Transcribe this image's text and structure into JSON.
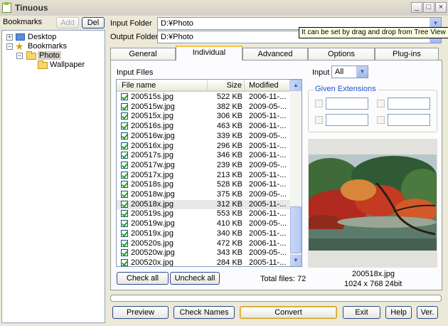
{
  "app": {
    "title": "Tinuous"
  },
  "window_controls": {
    "minimize": "_",
    "maximize": "□",
    "close": "×"
  },
  "bookmarks": {
    "label": "Bookmarks",
    "add_label": "Add",
    "del_label": "Del"
  },
  "tree": {
    "desktop": "Desktop",
    "bookmarks": "Bookmarks",
    "photo": "Photo",
    "wallpaper": "Wallpaper",
    "expanders": {
      "desktop": "+",
      "bookmarks": "−",
      "photo": "−"
    }
  },
  "input_folder": {
    "label": "Input Folder",
    "value": "D:¥Photo"
  },
  "output_folder": {
    "label": "Output Folder",
    "value": "D:¥Photo"
  },
  "tooltip": "It can be set by drag and drop from Tree View",
  "tabs": [
    "General",
    "Individual",
    "Advanced",
    "Options",
    "Plug-ins"
  ],
  "active_tab": "Individual",
  "input_files": {
    "label": "Input FIles",
    "columns": [
      "File name",
      "Size",
      "Modified"
    ],
    "rows": [
      {
        "name": "200515s.jpg",
        "size": "522 KB",
        "modified": "2006-11-..."
      },
      {
        "name": "200515w.jpg",
        "size": "382 KB",
        "modified": "2009-05-..."
      },
      {
        "name": "200515x.jpg",
        "size": "306 KB",
        "modified": "2005-11-..."
      },
      {
        "name": "200516s.jpg",
        "size": "463 KB",
        "modified": "2006-11-..."
      },
      {
        "name": "200516w.jpg",
        "size": "339 KB",
        "modified": "2009-05-..."
      },
      {
        "name": "200516x.jpg",
        "size": "296 KB",
        "modified": "2005-11-..."
      },
      {
        "name": "200517s.jpg",
        "size": "346 KB",
        "modified": "2006-11-..."
      },
      {
        "name": "200517w.jpg",
        "size": "239 KB",
        "modified": "2009-05-..."
      },
      {
        "name": "200517x.jpg",
        "size": "213 KB",
        "modified": "2005-11-..."
      },
      {
        "name": "200518s.jpg",
        "size": "528 KB",
        "modified": "2006-11-..."
      },
      {
        "name": "200518w.jpg",
        "size": "375 KB",
        "modified": "2009-05-..."
      },
      {
        "name": "200518x.jpg",
        "size": "312 KB",
        "modified": "2005-11-..."
      },
      {
        "name": "200519s.jpg",
        "size": "553 KB",
        "modified": "2006-11-..."
      },
      {
        "name": "200519w.jpg",
        "size": "410 KB",
        "modified": "2009-05-..."
      },
      {
        "name": "200519x.jpg",
        "size": "340 KB",
        "modified": "2005-11-..."
      },
      {
        "name": "200520s.jpg",
        "size": "472 KB",
        "modified": "2006-11-..."
      },
      {
        "name": "200520w.jpg",
        "size": "343 KB",
        "modified": "2009-05-..."
      },
      {
        "name": "200520x.jpg",
        "size": "284 KB",
        "modified": "2005-11-..."
      }
    ],
    "selected_row": "200518x.jpg",
    "check_all_label": "Check all",
    "uncheck_all_label": "Uncheck all",
    "total_files": "Total files: 72"
  },
  "input_filter": {
    "label": "Input",
    "value": "All"
  },
  "given_extensions": {
    "label": "Given Extensions"
  },
  "preview": {
    "filename": "200518x.jpg",
    "info": "1024 x 768  24bit"
  },
  "bottom_buttons": {
    "preview": "Preview",
    "check_names": "Check Names",
    "convert": "Convert",
    "exit": "Exit",
    "help": "Help",
    "ver": "Ver."
  },
  "colors": {
    "accent": "#2054c8",
    "tab_highlight": "#f6c343",
    "check": "#21a121"
  }
}
